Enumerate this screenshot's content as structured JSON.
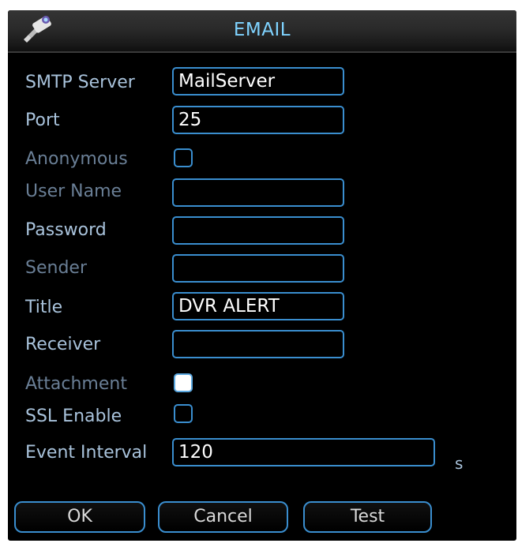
{
  "dialog": {
    "title": "EMAIL",
    "logo_icon": "camera-icon"
  },
  "fields": {
    "smtp_server": {
      "label": "SMTP Server",
      "value": "MailServer"
    },
    "port": {
      "label": "Port",
      "value": "25"
    },
    "anonymous": {
      "label": "Anonymous",
      "checked": false
    },
    "user_name": {
      "label": "User Name",
      "value": ""
    },
    "password": {
      "label": "Password",
      "value": ""
    },
    "sender": {
      "label": "Sender",
      "value": ""
    },
    "title": {
      "label": "Title",
      "value": "DVR ALERT"
    },
    "receiver": {
      "label": "Receiver",
      "value": ""
    },
    "attachment": {
      "label": "Attachment",
      "checked": true
    },
    "ssl_enable": {
      "label": "SSL Enable",
      "checked": false
    },
    "event_interval": {
      "label": "Event Interval",
      "value": "120",
      "unit": "s"
    }
  },
  "buttons": {
    "ok": "OK",
    "cancel": "Cancel",
    "test": "Test"
  },
  "colors": {
    "accent": "#3a8ecf",
    "title_text": "#7fd3ff",
    "label_text": "#6a7f96",
    "background": "#000000"
  }
}
